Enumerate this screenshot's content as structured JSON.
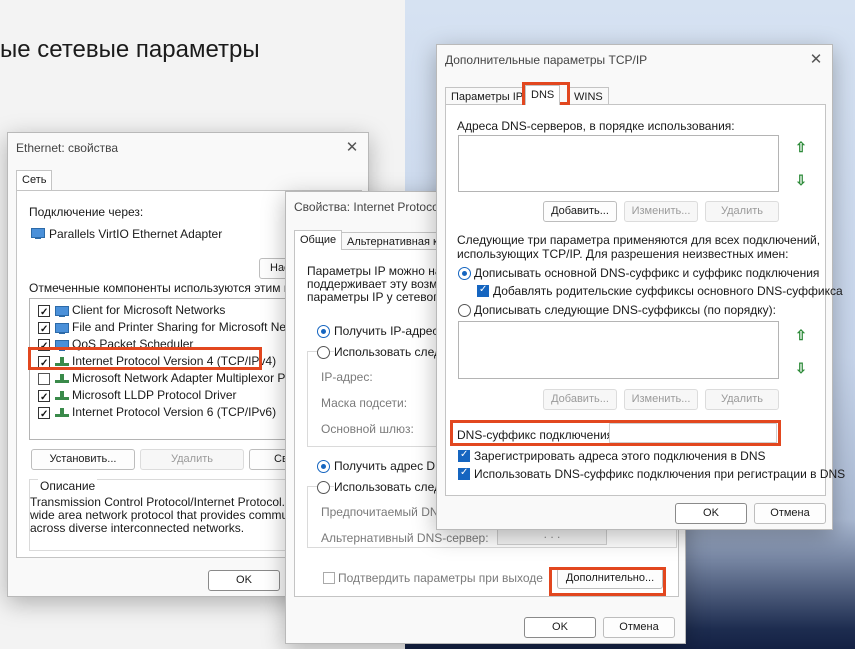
{
  "background": {
    "title": "ые сетевые параметры"
  },
  "eth": {
    "title": "Ethernet: свойства",
    "tab": "Сеть",
    "connect_via": "Подключение через:",
    "adapter": "Parallels VirtIO Ethernet Adapter",
    "configure_btn": "Нас",
    "components_label": "Отмеченные компоненты используются этим подк",
    "components": [
      {
        "label": "Client for Microsoft Networks",
        "checked": true,
        "icon": "network-icon"
      },
      {
        "label": "File and Printer Sharing for Microsoft Networks",
        "checked": true,
        "icon": "network-icon"
      },
      {
        "label": "QoS Packet Scheduler",
        "checked": true,
        "icon": "network-icon"
      },
      {
        "label": "Internet Protocol Version 4 (TCP/IPv4)",
        "checked": true,
        "icon": "protocol-icon"
      },
      {
        "label": "Microsoft Network Adapter Multiplexor Protoco",
        "checked": false,
        "icon": "protocol-icon"
      },
      {
        "label": "Microsoft LLDP Protocol Driver",
        "checked": true,
        "icon": "protocol-icon"
      },
      {
        "label": "Internet Protocol Version 6 (TCP/IPv6)",
        "checked": true,
        "icon": "protocol-icon"
      }
    ],
    "install_btn": "Установить...",
    "remove_btn": "Удалить",
    "properties_btn": "Св",
    "description_title": "Описание",
    "description_lines": [
      "Transmission Control Protocol/Internet Protocol. The",
      "wide area network protocol that provides communica",
      "across diverse interconnected networks."
    ],
    "ok_btn": "OK"
  },
  "ipv4": {
    "title": "Свойства: Internet Protoco",
    "tab_general": "Общие",
    "tab_alt": "Альтернативная ко",
    "intro_lines": [
      "Параметры IP можно назн",
      "поддерживает эту возмо",
      "параметры IP у сетевого"
    ],
    "auto_ip": "Получить IP-адрес а",
    "manual_ip": "Использовать следу",
    "ip_address": "IP-адрес:",
    "subnet_mask": "Маска подсети:",
    "gateway": "Основной шлюз:",
    "auto_dns": "Получить адрес DNS",
    "manual_dns": "Использовать следу",
    "preferred_dns": "Предпочитаемый DNS-се",
    "alternate_dns": "Альтернативный DNS-сервер:",
    "alternate_dns_value": ". . .",
    "validate": "Подтвердить параметры при выходе",
    "advanced_btn": "Дополнительно...",
    "ok_btn": "OK",
    "cancel_btn": "Отмена"
  },
  "adv": {
    "title": "Дополнительные параметры TCP/IP",
    "tabs": [
      "Параметры IP",
      "DNS",
      "WINS"
    ],
    "dns_servers_label": "Адреса DNS-серверов, в порядке использования:",
    "add_btn": "Добавить...",
    "edit_btn": "Изменить...",
    "remove_btn": "Удалить",
    "info_lines": [
      "Следующие три параметра применяются для всех подключений,",
      "использующих TCP/IP. Для разрешения неизвестных имен:"
    ],
    "append_primary": "Дописывать основной DNS-суффикс и суффикс подключения",
    "append_parent": "Добавлять родительские суффиксы основного DNS-суффикса",
    "append_these": "Дописывать следующие DNS-суффиксы (по порядку):",
    "add_btn2": "Добавить...",
    "edit_btn2": "Изменить...",
    "remove_btn2": "Удалить",
    "suffix_label": "DNS-суффикс подключения:",
    "register": "Зарегистрировать адреса этого подключения в DNS",
    "use_suffix": "Использовать DNS-суффикс подключения при регистрации в DNS",
    "ok_btn": "OK",
    "cancel_btn": "Отмена"
  },
  "colors": {
    "highlight": "#e2471f",
    "accent": "#1565c0",
    "arrow": "#2e8b3a"
  }
}
